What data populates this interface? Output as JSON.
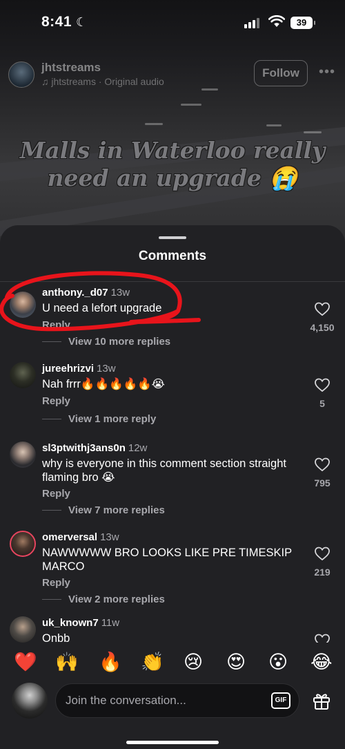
{
  "status_bar": {
    "time": "8:41",
    "battery": "39"
  },
  "reel": {
    "username": "jhtstreams",
    "audio": "jhtstreams · Original audio",
    "follow_label": "Follow",
    "caption_line1": "Malls in Waterloo really",
    "caption_line2": "need an upgrade 😭"
  },
  "comments_sheet": {
    "title": "Comments",
    "comments": [
      {
        "username": "anthony._d07",
        "time": "13w",
        "text": "U need a lefort upgrade",
        "reply_label": "Reply",
        "more_replies": "View 10 more replies",
        "likes": "4,150"
      },
      {
        "username": "jureehrizvi",
        "time": "13w",
        "text": "Nah frrr🔥🔥🔥🔥🔥😭",
        "reply_label": "Reply",
        "more_replies": "View 1 more reply",
        "likes": "5"
      },
      {
        "username": "sl3ptwithj3ans0n",
        "time": "12w",
        "text": "why is everyone in this comment section straight flaming bro 😭",
        "reply_label": "Reply",
        "more_replies": "View 7 more replies",
        "likes": "795"
      },
      {
        "username": "omerversal",
        "time": "13w",
        "text": "NAWWWWW BRO LOOKS LIKE PRE TIMESKIP MARCO",
        "reply_label": "Reply",
        "more_replies": "View 2 more replies",
        "likes": "219"
      },
      {
        "username": "uk_known7",
        "time": "11w",
        "text": "Onbb"
      }
    ]
  },
  "emoji_bar": [
    "❤️",
    "🙌",
    "🔥",
    "👏",
    "😢",
    "😍",
    "😮",
    "😂"
  ],
  "composer": {
    "placeholder": "Join the conversation...",
    "gif_label": "GIF"
  },
  "colors": {
    "sheet_bg": "#212124",
    "annotation": "#e8141b",
    "secondary_text": "#a8a8ad"
  }
}
